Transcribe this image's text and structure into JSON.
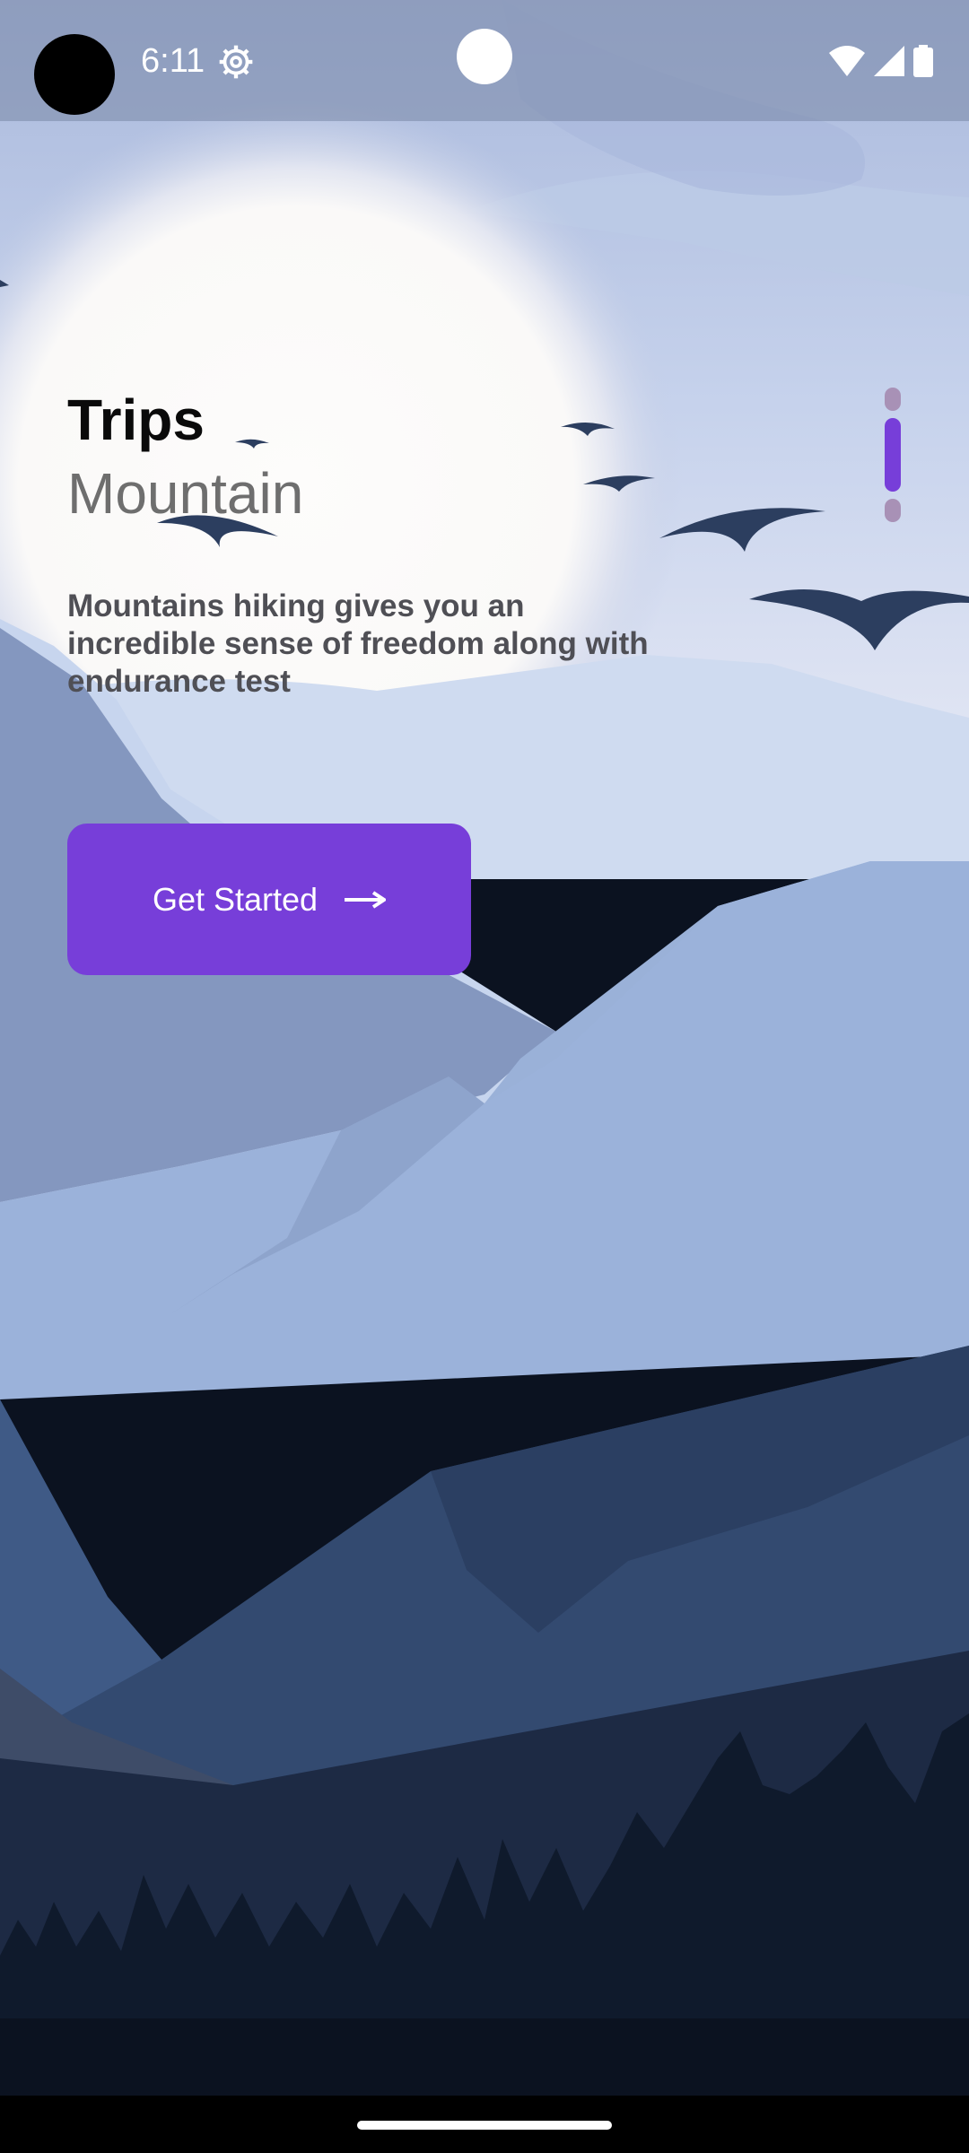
{
  "status_bar": {
    "time": "6:11",
    "icons": [
      "settings-gear-icon",
      "wifi-icon",
      "cell-signal-icon",
      "battery-icon"
    ]
  },
  "main": {
    "title": "Trips",
    "subtitle": "Mountain",
    "description": "Mountains hiking gives you an incredible sense of freedom along with endurance test",
    "cta_label": "Get Started",
    "cta_icon": "arrow-right-icon"
  },
  "page_indicator": {
    "count": 3,
    "active_index": 1
  },
  "colors": {
    "accent": "#773ed9",
    "inactive_indicator": "#a891b6",
    "sky": "#c9d6ee",
    "mountain_dark": "#2c3e5f"
  }
}
